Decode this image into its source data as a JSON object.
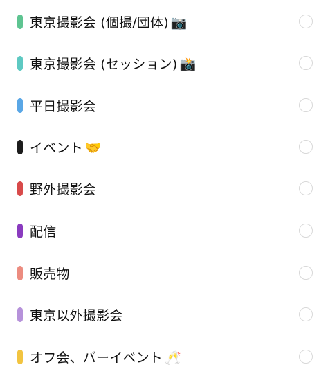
{
  "items": [
    {
      "label": "東京撮影会 (個撮/団体)",
      "emoji": "📷",
      "color": "#5ec491"
    },
    {
      "label": "東京撮影会 (セッション)",
      "emoji": "📸",
      "color": "#5ec9c2"
    },
    {
      "label": "平日撮影会",
      "emoji": "",
      "color": "#5aa7e6"
    },
    {
      "label": "イベント",
      "emoji": "🤝",
      "color": "#1c1c1c"
    },
    {
      "label": "野外撮影会",
      "emoji": "",
      "color": "#d84a4a"
    },
    {
      "label": "配信",
      "emoji": "",
      "color": "#8a3bbf"
    },
    {
      "label": "販売物",
      "emoji": "",
      "color": "#ec8c80"
    },
    {
      "label": "東京以外撮影会",
      "emoji": "",
      "color": "#b692da"
    },
    {
      "label": "オフ会、バーイベント",
      "emoji": "🥂",
      "color": "#f2c440"
    }
  ]
}
